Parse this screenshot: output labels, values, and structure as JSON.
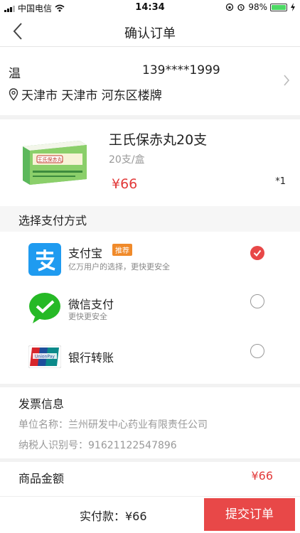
{
  "status_bar": {
    "carrier": "中国电信",
    "time": "14:34",
    "battery": "98%",
    "battery_level": 0.98
  },
  "nav": {
    "title": "确认订单",
    "back_icon": "chevron-left-icon"
  },
  "address": {
    "name": "温",
    "phone": "139****1999",
    "location": "天津市 天津市 河东区楼牌"
  },
  "product": {
    "name": "王氏保赤丸20支",
    "spec": "20支/盒",
    "price": "¥66",
    "quantity": "*1",
    "box_label": "王氏保赤丸"
  },
  "payment": {
    "title": "选择支付方式",
    "options": [
      {
        "label": "支付宝",
        "sub": "亿万用户的选择，更快更安全",
        "tag": "推荐",
        "selected": true
      },
      {
        "label": "微信支付",
        "sub": "更快更安全",
        "selected": false
      },
      {
        "label": "银行转账",
        "sub": "",
        "selected": false
      }
    ]
  },
  "invoice": {
    "title": "发票信息",
    "company": "单位名称：兰州研发中心药业有限责任公司",
    "tax_id": "纳税人识别号：91621122547896"
  },
  "summary": {
    "label": "商品金额",
    "value": "¥66"
  },
  "bottom": {
    "pay_text": "实付款：¥66",
    "submit": "提交订单"
  },
  "colors": {
    "accent": "#e84848",
    "alipay": "#1f9bf0",
    "wechat": "#26b926"
  }
}
